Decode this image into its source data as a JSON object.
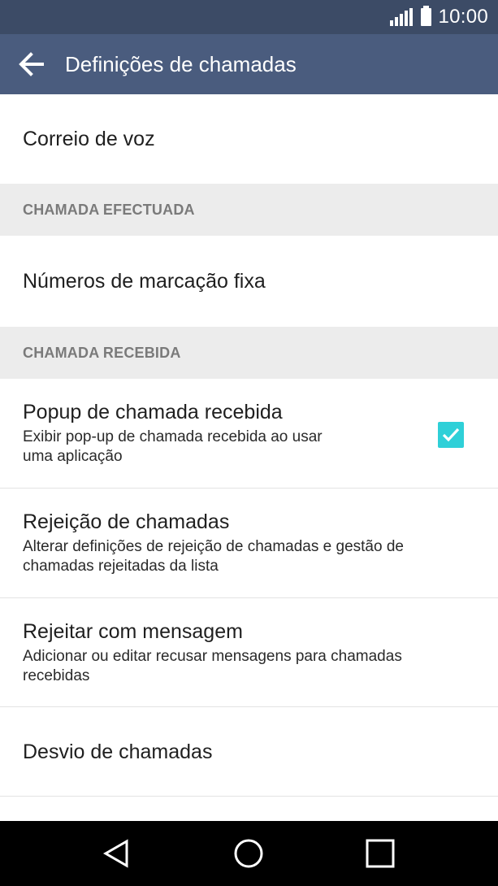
{
  "status_bar": {
    "time": "10:00",
    "icons": [
      "signal-icon",
      "battery-icon"
    ]
  },
  "action_bar": {
    "title": "Definições de chamadas",
    "back_icon": "arrow-left-icon"
  },
  "list": {
    "voicemail": {
      "title": "Correio de voz"
    },
    "section_outgoing": "CHAMADA EFECTUADA",
    "fixed_dialing": {
      "title": "Números de marcação fixa"
    },
    "section_incoming": "CHAMADA RECEBIDA",
    "incoming_popup": {
      "title": "Popup de chamada recebida",
      "summary_line1": "Exibir pop-up de chamada recebida ao usar",
      "summary_line2": "uma aplicação",
      "checked": true
    },
    "call_reject": {
      "title": "Rejeição de chamadas",
      "summary_line1": "Alterar definições de rejeição de chamadas e gestão de",
      "summary_line2": "chamadas rejeitadas da lista"
    },
    "reject_message": {
      "title": "Rejeitar com mensagem",
      "summary_line1": "Adicionar ou editar recusar mensagens para chamadas",
      "summary_line2": "recebidas"
    },
    "call_forwarding": {
      "title": "Desvio de chamadas"
    }
  },
  "nav_bar": {
    "icons": [
      "nav-back-icon",
      "nav-home-icon",
      "nav-recent-apps-icon"
    ]
  },
  "colors": {
    "status_bar": "#3c4b66",
    "action_bar": "#4a5c7e",
    "checkbox_accent": "#2fd0d8",
    "section_header_bg": "#ececec"
  }
}
